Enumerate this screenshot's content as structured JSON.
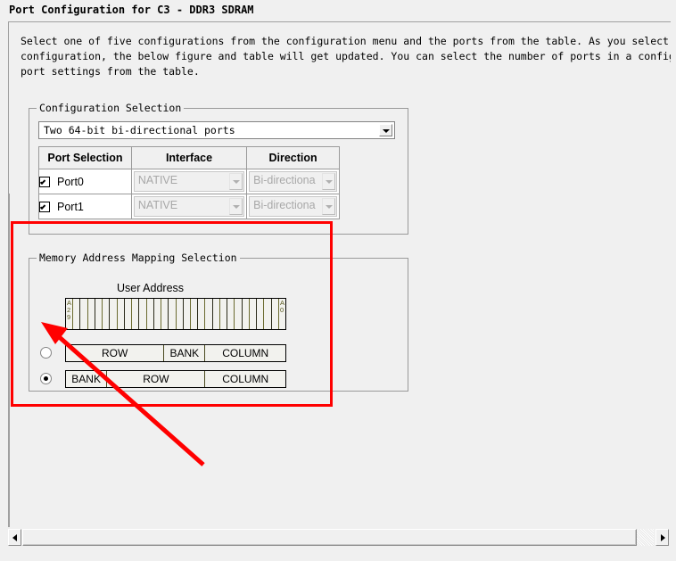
{
  "window": {
    "title": "Port Configuration for C3 - DDR3 SDRAM"
  },
  "description": {
    "line1": "Select one of five configurations from the configuration menu and the ports from the table. As you select the port",
    "line2": "configuration, the below figure and table will get updated. You can select the number of ports in a configuration, and da",
    "line3": "port settings from the table."
  },
  "config_group": {
    "title": "Configuration Selection",
    "combo": {
      "selected": "Two 64-bit bi-directional ports",
      "arrow_icon": "chevron-down-icon"
    },
    "table": {
      "headers": [
        "Port Selection",
        "Interface",
        "Direction"
      ],
      "rows": [
        {
          "checked": true,
          "port": "Port0",
          "interface": "NATIVE",
          "direction": "Bi-directiona"
        },
        {
          "checked": true,
          "port": "Port1",
          "interface": "NATIVE",
          "direction": "Bi-directiona"
        }
      ]
    }
  },
  "memory_group": {
    "title": "Memory Address Mapping Selection",
    "figure_label": "User Address",
    "address_bar": {
      "msb_label": "A29",
      "lsb_label": "A0",
      "bit_count": 30
    },
    "options": [
      {
        "selected": false,
        "segments": [
          {
            "label": "ROW",
            "flex": 111
          },
          {
            "label": "BANK",
            "flex": 46
          },
          {
            "label": "COLUMN",
            "flex": 91
          }
        ]
      },
      {
        "selected": true,
        "segments": [
          {
            "label": "BANK",
            "flex": 46
          },
          {
            "label": "ROW",
            "flex": 111
          },
          {
            "label": "COLUMN",
            "flex": 91
          }
        ]
      }
    ]
  },
  "annotation": {
    "highlight_color": "#ff0000",
    "shape": "rectangle-with-arrow"
  },
  "scrollbar": {
    "left_arrow_icon": "triangle-left-icon",
    "right_arrow_icon": "triangle-right-icon"
  }
}
